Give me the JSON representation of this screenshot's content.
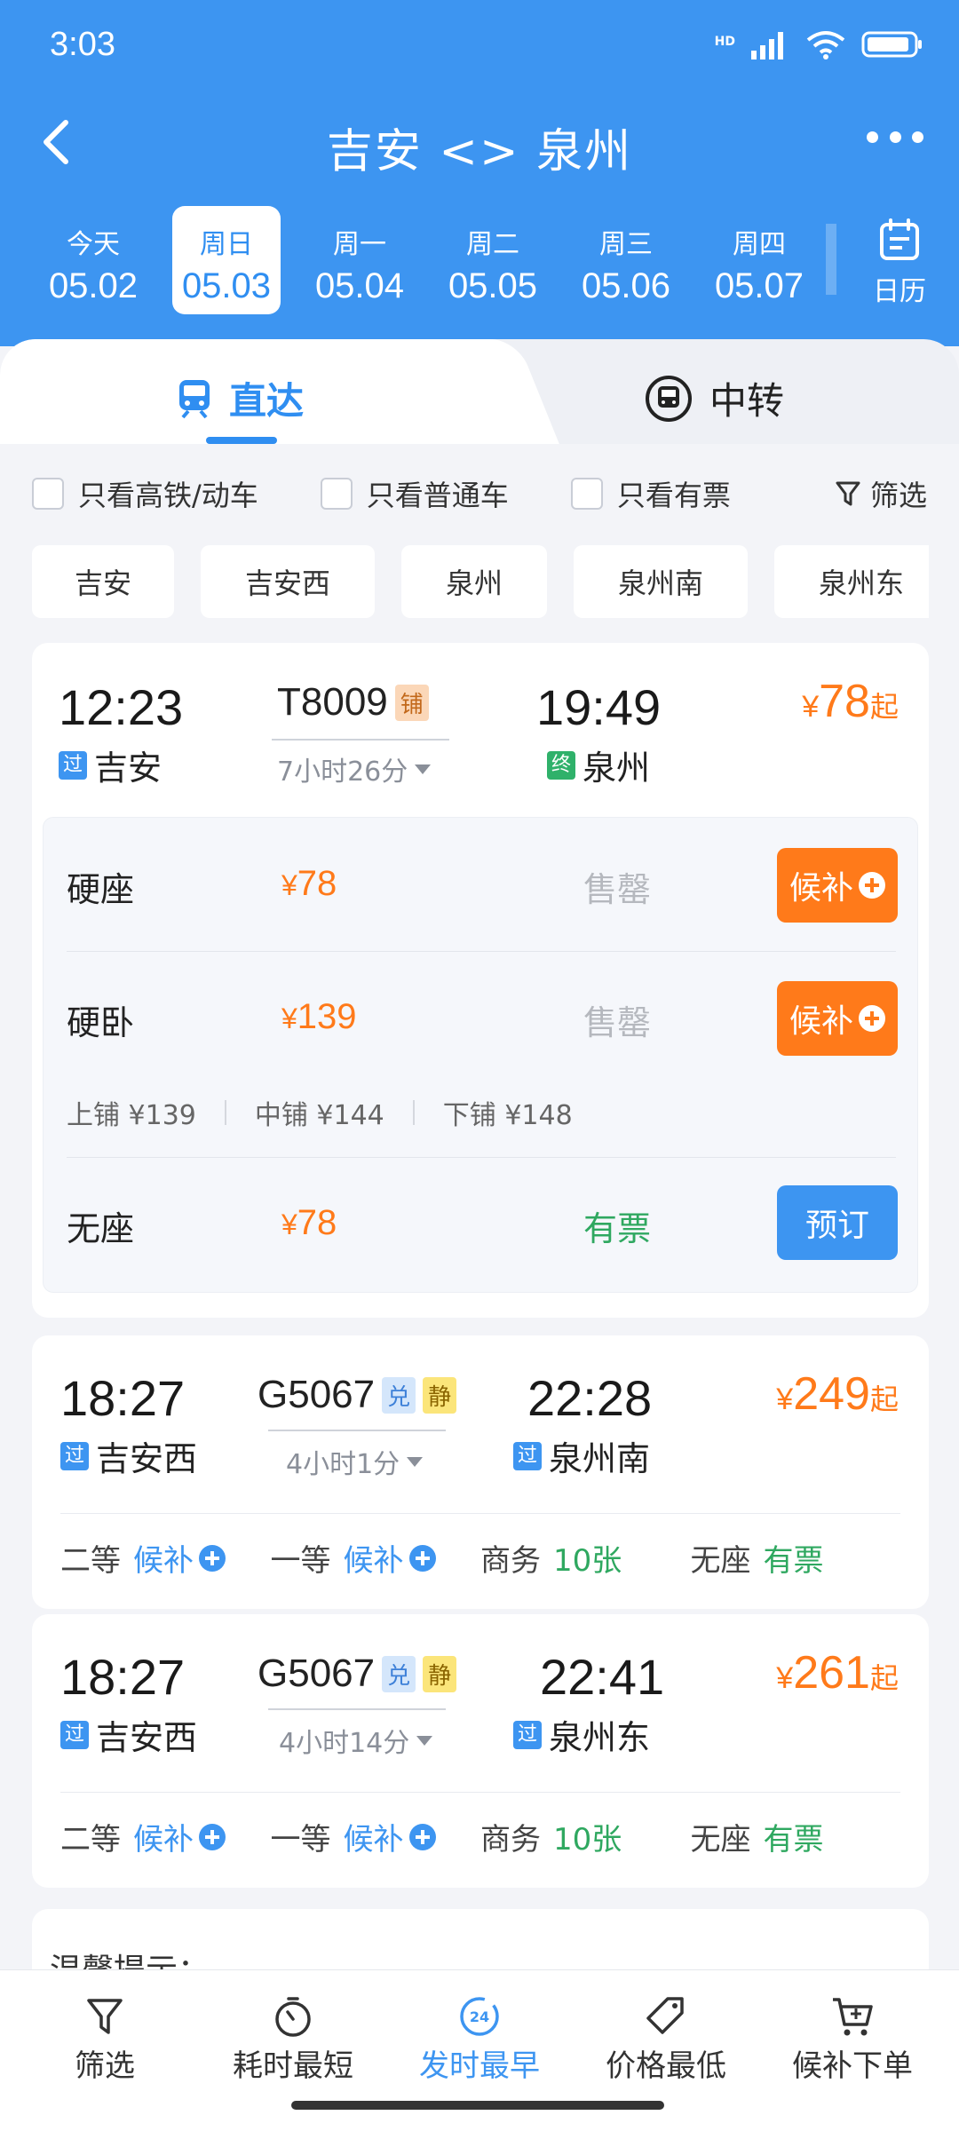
{
  "status": {
    "time": "3:03",
    "network": "HD"
  },
  "nav": {
    "title": "吉安 <> 泉州"
  },
  "dates": [
    {
      "weekday": "今天",
      "date": "05.02"
    },
    {
      "weekday": "周日",
      "date": "05.03"
    },
    {
      "weekday": "周一",
      "date": "05.04"
    },
    {
      "weekday": "周二",
      "date": "05.05"
    },
    {
      "weekday": "周三",
      "date": "05.06"
    },
    {
      "weekday": "周四",
      "date": "05.07"
    }
  ],
  "calendar_label": "日历",
  "tabs": {
    "direct": "直达",
    "transfer": "中转"
  },
  "filters": {
    "hs": "只看高铁/动车",
    "normal": "只看普通车",
    "available": "只看有票",
    "filter": "筛选"
  },
  "stations": [
    "吉安",
    "吉安西",
    "泉州",
    "泉州南",
    "泉州东"
  ],
  "train1": {
    "dep_time": "12:23",
    "dep_station": "吉安",
    "dep_tag": "过",
    "train_no": "T8009",
    "badge": "铺",
    "duration": "7小时26分",
    "arr_time": "19:49",
    "arr_station": "泉州",
    "arr_tag": "终",
    "price_yen": "¥",
    "price": "78",
    "price_qi": "起",
    "seats": [
      {
        "name": "硬座",
        "price": "78",
        "status": "售罄",
        "action": "候补"
      },
      {
        "name": "硬卧",
        "price": "139",
        "status": "售罄",
        "action": "候补"
      },
      {
        "name": "无座",
        "price": "78",
        "status": "有票",
        "action": "预订"
      }
    ],
    "berths": [
      "上铺 ¥139",
      "中铺 ¥144",
      "下铺 ¥148"
    ]
  },
  "train2": {
    "dep_time": "18:27",
    "dep_station": "吉安西",
    "dep_tag": "过",
    "train_no": "G5067",
    "badge1": "兑",
    "badge2": "静",
    "duration": "4小时1分",
    "arr_time": "22:28",
    "arr_station": "泉州南",
    "arr_tag": "过",
    "price": "249",
    "price_qi": "起",
    "classes": [
      {
        "name": "二等",
        "value": "候补"
      },
      {
        "name": "一等",
        "value": "候补"
      },
      {
        "name": "商务",
        "value": "10张"
      },
      {
        "name": "无座",
        "value": "有票"
      }
    ]
  },
  "train3": {
    "dep_time": "18:27",
    "dep_station": "吉安西",
    "dep_tag": "过",
    "train_no": "G5067",
    "badge1": "兑",
    "badge2": "静",
    "duration": "4小时14分",
    "arr_time": "22:41",
    "arr_station": "泉州东",
    "arr_tag": "过",
    "price": "261",
    "price_qi": "起",
    "classes": [
      {
        "name": "二等",
        "value": "候补"
      },
      {
        "name": "一等",
        "value": "候补"
      },
      {
        "name": "商务",
        "value": "10张"
      },
      {
        "name": "无座",
        "value": "有票"
      }
    ]
  },
  "notice": {
    "title": "温馨提示："
  },
  "bottom": {
    "filter": "筛选",
    "shortest": "耗时最短",
    "earliest": "发时最早",
    "earliest_icon": "24",
    "cheapest": "价格最低",
    "waitlist": "候补下单"
  },
  "colors": {
    "primary": "#3d95f1",
    "orange": "#ff7a1a",
    "green": "#2fa860"
  }
}
